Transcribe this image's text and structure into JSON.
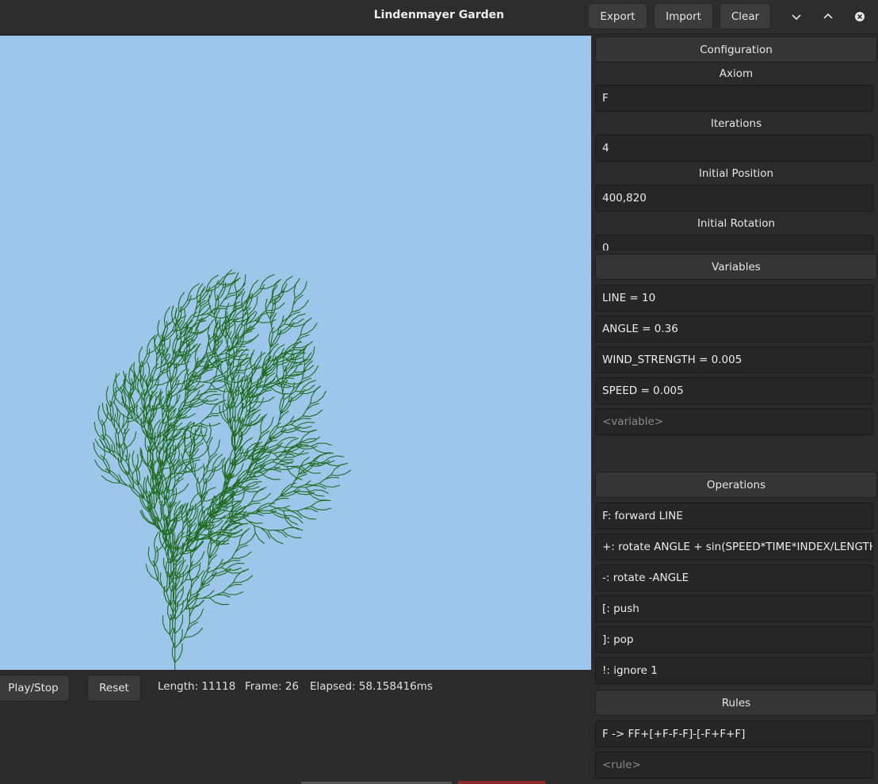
{
  "window": {
    "title": "Lindenmayer Garden",
    "export_label": "Export",
    "import_label": "Import",
    "clear_label": "Clear",
    "minimize_icon": "chevron-down-icon",
    "maximize_icon": "chevron-up-icon",
    "close_icon": "close-circle-icon"
  },
  "colors": {
    "canvas_bg": "#9dc6ea",
    "plant_stroke": "#1f6b1f",
    "panel_bg": "#2b2b2b"
  },
  "controls": {
    "play_stop_label": "Play/Stop",
    "reset_label": "Reset",
    "length": "Length: 11118",
    "frame": "Frame: 26",
    "elapsed": "Elapsed: 58.158416ms"
  },
  "configuration": {
    "header": "Configuration",
    "axiom_label": "Axiom",
    "axiom_value": "F",
    "iterations_label": "Iterations",
    "iterations_value": "4",
    "position_label": "Initial Position",
    "position_value": "400,820",
    "rotation_label": "Initial Rotation",
    "rotation_value": "0"
  },
  "variables": {
    "header": "Variables",
    "items": [
      "LINE = 10",
      "ANGLE = 0.36",
      "WIND_STRENGTH = 0.005",
      "SPEED = 0.005"
    ],
    "placeholder": "<variable>"
  },
  "operations": {
    "header": "Operations",
    "items": [
      "F: forward LINE",
      "+: rotate ANGLE + sin(SPEED*TIME*INDEX/LENGTH)*WIND_STRENGTH",
      "-: rotate -ANGLE",
      "[: push",
      "]: pop",
      "!: ignore 1"
    ]
  },
  "rules": {
    "header": "Rules",
    "items": [
      "F -> FF+[+F-F-F]-[-F+F+F]"
    ],
    "placeholder": "<rule>"
  }
}
